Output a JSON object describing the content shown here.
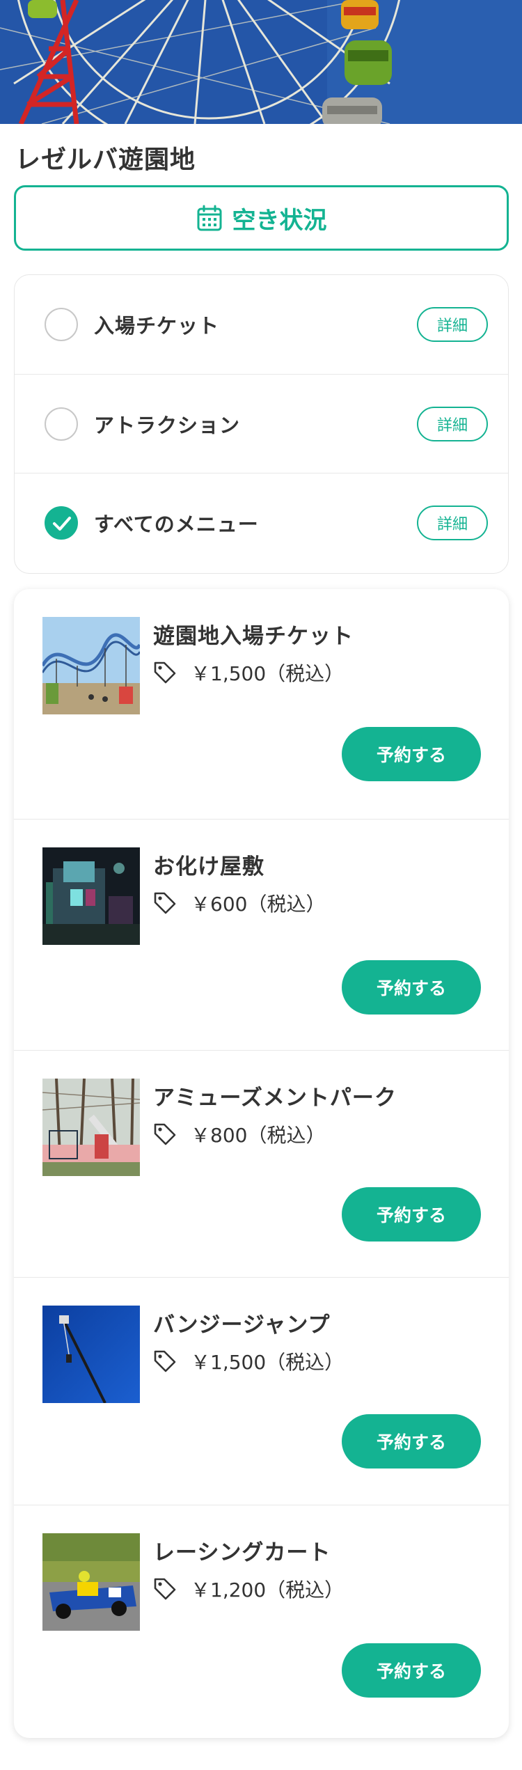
{
  "page": {
    "title": "レゼルバ遊園地",
    "availability_label": "空き状況"
  },
  "filters": [
    {
      "label": "入場チケット",
      "checked": false,
      "detail_label": "詳細"
    },
    {
      "label": "アトラクション",
      "checked": false,
      "detail_label": "詳細"
    },
    {
      "label": "すべてのメニュー",
      "checked": true,
      "detail_label": "詳細"
    }
  ],
  "menu": [
    {
      "name": "遊園地入場チケット",
      "price": "￥1,500（税込）",
      "book_label": "予約する"
    },
    {
      "name": "お化け屋敷",
      "price": "￥600（税込）",
      "book_label": "予約する"
    },
    {
      "name": "アミューズメントパーク",
      "price": "￥800（税込）",
      "book_label": "予約する"
    },
    {
      "name": "バンジージャンプ",
      "price": "￥1,500（税込）",
      "book_label": "予約する"
    },
    {
      "name": "レーシングカート",
      "price": "￥1,200（税込）",
      "book_label": "予約する"
    }
  ],
  "colors": {
    "accent": "#14b392",
    "text": "#333333",
    "border": "#e6e6e6"
  },
  "icons": {
    "availability": "calendar-icon",
    "price": "price-tag-icon",
    "checked": "check-icon"
  }
}
